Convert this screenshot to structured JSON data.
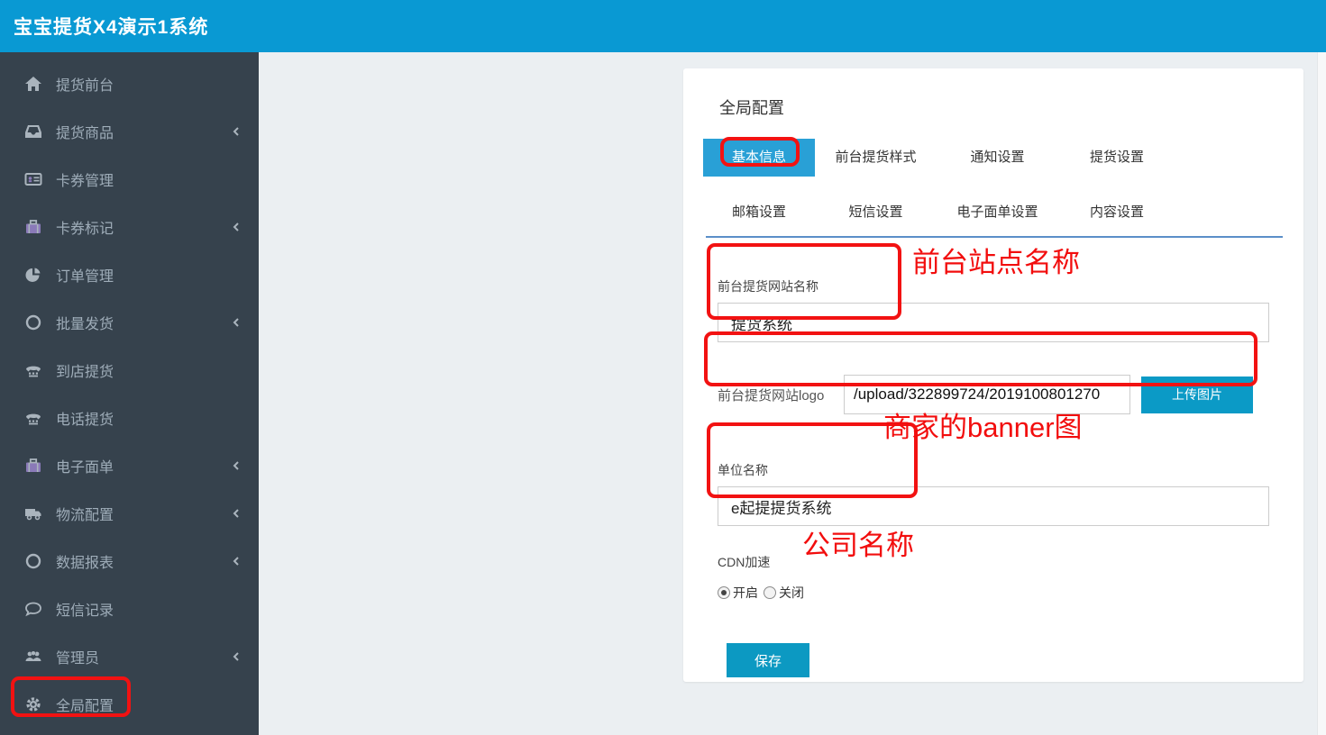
{
  "header": {
    "title": "宝宝提货X4演示1系统"
  },
  "sidebar": {
    "items": [
      {
        "label": "提货前台",
        "icon": "home-icon",
        "has_submenu": false
      },
      {
        "label": "提货商品",
        "icon": "inbox-icon",
        "has_submenu": true
      },
      {
        "label": "卡券管理",
        "icon": "id-card-icon",
        "has_submenu": false
      },
      {
        "label": "卡券标记",
        "icon": "briefcase-icon",
        "has_submenu": true
      },
      {
        "label": "订单管理",
        "icon": "pie-chart-icon",
        "has_submenu": false
      },
      {
        "label": "批量发货",
        "icon": "circle-icon",
        "has_submenu": true
      },
      {
        "label": "到店提货",
        "icon": "phone-icon",
        "has_submenu": false
      },
      {
        "label": "电话提货",
        "icon": "phone-icon",
        "has_submenu": false
      },
      {
        "label": "电子面单",
        "icon": "briefcase-icon",
        "has_submenu": true
      },
      {
        "label": "物流配置",
        "icon": "truck-icon",
        "has_submenu": true
      },
      {
        "label": "数据报表",
        "icon": "circle-icon",
        "has_submenu": true
      },
      {
        "label": "短信记录",
        "icon": "comment-icon",
        "has_submenu": false
      },
      {
        "label": "管理员",
        "icon": "users-icon",
        "has_submenu": true
      },
      {
        "label": "全局配置",
        "icon": "gear-icon",
        "has_submenu": false,
        "annotated": true
      }
    ]
  },
  "main": {
    "title": "全局配置",
    "tabs_row1": [
      {
        "label": "基本信息",
        "active": true,
        "annotated": true
      },
      {
        "label": "前台提货样式",
        "active": false
      },
      {
        "label": "通知设置",
        "active": false
      },
      {
        "label": "提货设置",
        "active": false
      }
    ],
    "tabs_row2": [
      {
        "label": "邮箱设置",
        "active": false
      },
      {
        "label": "短信设置",
        "active": false
      },
      {
        "label": "电子面单设置",
        "active": false
      },
      {
        "label": "内容设置",
        "active": false
      }
    ],
    "form": {
      "site_name": {
        "label": "前台提货网站名称",
        "value": "提货系统"
      },
      "logo": {
        "label": "前台提货网站logo",
        "value": "/upload/322899724/2019100801270",
        "button_label": "上传图片"
      },
      "company": {
        "label": "单位名称",
        "value": "e起提提货系统"
      },
      "cdn": {
        "label": "CDN加速",
        "options": [
          {
            "label": "开启",
            "checked": true
          },
          {
            "label": "关闭",
            "checked": false
          }
        ]
      },
      "save_label": "保存"
    }
  },
  "annotations": {
    "sidebar_global_config_boxed": true,
    "basic_info_tab_boxed": true,
    "site_name_note": "前台站点名称",
    "banner_note": "商家的banner图",
    "company_note": "公司名称"
  },
  "colors": {
    "topbar_blue": "#0999d3",
    "sidebar_dark": "#36424d",
    "active_tab_blue": "#29a0d6",
    "button_blue": "#0b9ac6",
    "tab_underline_blue": "#5b8fc8",
    "annotation_red": "#f21212",
    "content_background": "#ebeff2"
  }
}
